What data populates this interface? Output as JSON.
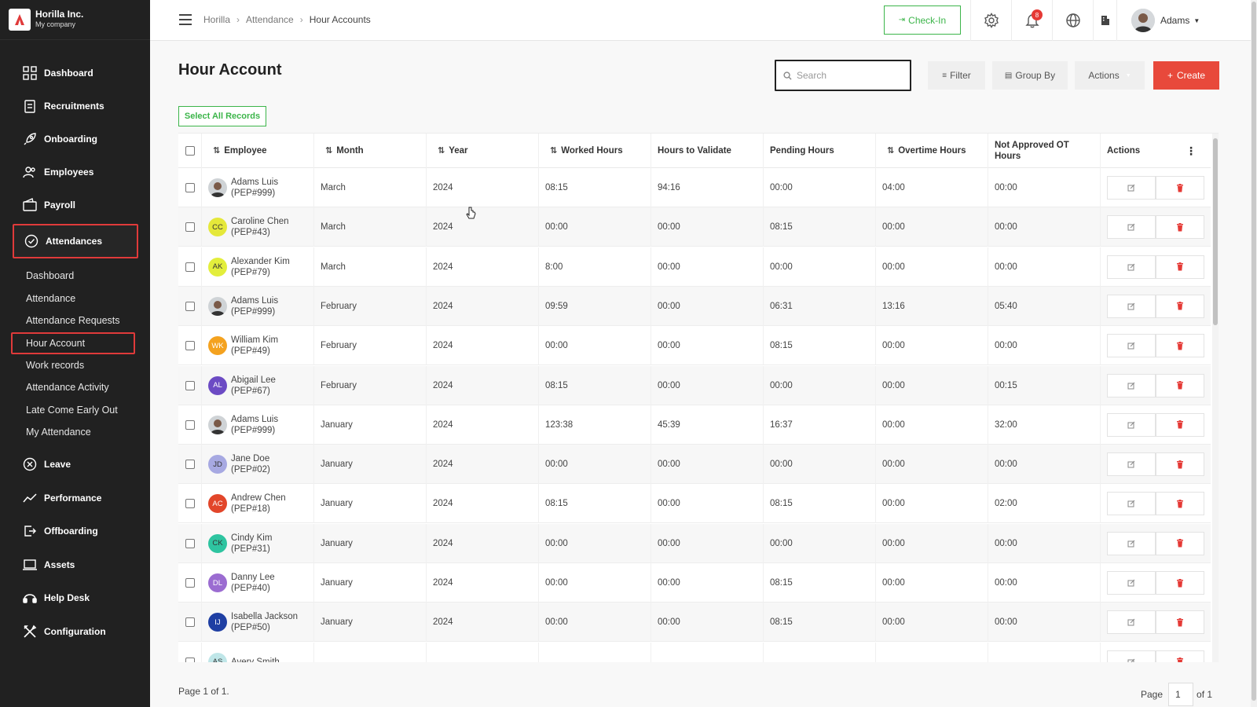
{
  "brand": {
    "name": "Horilla Inc.",
    "subtitle": "My company"
  },
  "sidebar": {
    "items": [
      {
        "label": "Dashboard",
        "icon": "grid-icon"
      },
      {
        "label": "Recruitments",
        "icon": "clipboard-icon"
      },
      {
        "label": "Onboarding",
        "icon": "rocket-icon"
      },
      {
        "label": "Employees",
        "icon": "users-icon"
      },
      {
        "label": "Payroll",
        "icon": "wallet-icon"
      },
      {
        "label": "Attendances",
        "icon": "check-circle-icon",
        "active": true
      },
      {
        "label": "Leave",
        "icon": "x-circle-icon"
      },
      {
        "label": "Performance",
        "icon": "trend-icon"
      },
      {
        "label": "Offboarding",
        "icon": "exit-icon"
      },
      {
        "label": "Assets",
        "icon": "laptop-icon"
      },
      {
        "label": "Help Desk",
        "icon": "headset-icon"
      },
      {
        "label": "Configuration",
        "icon": "tools-icon"
      }
    ],
    "sub_items": [
      {
        "label": "Dashboard"
      },
      {
        "label": "Attendance"
      },
      {
        "label": "Attendance Requests"
      },
      {
        "label": "Hour Account",
        "active": true
      },
      {
        "label": "Work records"
      },
      {
        "label": "Attendance Activity"
      },
      {
        "label": "Late Come Early Out"
      },
      {
        "label": "My Attendance"
      }
    ]
  },
  "topbar": {
    "breadcrumb": [
      "Horilla",
      "Attendance",
      "Hour Accounts"
    ],
    "checkin_label": "Check-In",
    "notification_count": "8",
    "user_name": "Adams"
  },
  "page": {
    "title": "Hour Account",
    "search_placeholder": "Search",
    "filter_label": "Filter",
    "group_by_label": "Group By",
    "actions_label": "Actions",
    "create_label": "Create",
    "select_all_label": "Select All Records"
  },
  "table": {
    "headers": [
      "Employee",
      "Month",
      "Year",
      "Worked Hours",
      "Hours to Validate",
      "Pending Hours",
      "Overtime Hours",
      "Not Approved OT Hours",
      "Actions"
    ],
    "rows": [
      {
        "name": "Adams Luis",
        "id": "(PEP#999)",
        "initials": "",
        "avatar_color": "#cfd3d6",
        "photo": true,
        "month": "March",
        "year": "2024",
        "worked": "08:15",
        "validate": "94:16",
        "pending": "00:00",
        "overtime": "04:00",
        "not_approved": "00:00"
      },
      {
        "name": "Caroline Chen",
        "id": "(PEP#43)",
        "initials": "CC",
        "avatar_color": "#e5e83a",
        "photo": false,
        "month": "March",
        "year": "2024",
        "worked": "00:00",
        "validate": "00:00",
        "pending": "08:15",
        "overtime": "00:00",
        "not_approved": "00:00"
      },
      {
        "name": "Alexander Kim",
        "id": "(PEP#79)",
        "initials": "AK",
        "avatar_color": "#e3ee3c",
        "photo": false,
        "month": "March",
        "year": "2024",
        "worked": "8:00",
        "validate": "00:00",
        "pending": "00:00",
        "overtime": "00:00",
        "not_approved": "00:00"
      },
      {
        "name": "Adams Luis",
        "id": "(PEP#999)",
        "initials": "",
        "avatar_color": "#cfd3d6",
        "photo": true,
        "month": "February",
        "year": "2024",
        "worked": "09:59",
        "validate": "00:00",
        "pending": "06:31",
        "overtime": "13:16",
        "not_approved": "05:40"
      },
      {
        "name": "William Kim",
        "id": "(PEP#49)",
        "initials": "WK",
        "avatar_color": "#f4a21f",
        "photo": false,
        "month": "February",
        "year": "2024",
        "worked": "00:00",
        "validate": "00:00",
        "pending": "08:15",
        "overtime": "00:00",
        "not_approved": "00:00"
      },
      {
        "name": "Abigail Lee",
        "id": "(PEP#67)",
        "initials": "AL",
        "avatar_color": "#6c4bc4",
        "photo": false,
        "month": "February",
        "year": "2024",
        "worked": "08:15",
        "validate": "00:00",
        "pending": "00:00",
        "overtime": "00:00",
        "not_approved": "00:15"
      },
      {
        "name": "Adams Luis",
        "id": "(PEP#999)",
        "initials": "",
        "avatar_color": "#cfd3d6",
        "photo": true,
        "month": "January",
        "year": "2024",
        "worked": "123:38",
        "validate": "45:39",
        "pending": "16:37",
        "overtime": "00:00",
        "not_approved": "32:00"
      },
      {
        "name": "Jane Doe",
        "id": "(PEP#02)",
        "initials": "JD",
        "avatar_color": "#a7a9e2",
        "photo": false,
        "month": "January",
        "year": "2024",
        "worked": "00:00",
        "validate": "00:00",
        "pending": "00:00",
        "overtime": "00:00",
        "not_approved": "00:00"
      },
      {
        "name": "Andrew Chen",
        "id": "(PEP#18)",
        "initials": "AC",
        "avatar_color": "#e2462a",
        "photo": false,
        "month": "January",
        "year": "2024",
        "worked": "08:15",
        "validate": "00:00",
        "pending": "08:15",
        "overtime": "00:00",
        "not_approved": "02:00"
      },
      {
        "name": "Cindy Kim",
        "id": "(PEP#31)",
        "initials": "CK",
        "avatar_color": "#2ec4a0",
        "photo": false,
        "month": "January",
        "year": "2024",
        "worked": "00:00",
        "validate": "00:00",
        "pending": "00:00",
        "overtime": "00:00",
        "not_approved": "00:00"
      },
      {
        "name": "Danny Lee",
        "id": "(PEP#40)",
        "initials": "DL",
        "avatar_color": "#9b6cd1",
        "photo": false,
        "month": "January",
        "year": "2024",
        "worked": "00:00",
        "validate": "00:00",
        "pending": "08:15",
        "overtime": "00:00",
        "not_approved": "00:00"
      },
      {
        "name": "Isabella Jackson",
        "id": "(PEP#50)",
        "initials": "IJ",
        "avatar_color": "#1f3fa3",
        "photo": false,
        "month": "January",
        "year": "2024",
        "worked": "00:00",
        "validate": "00:00",
        "pending": "08:15",
        "overtime": "00:00",
        "not_approved": "00:00"
      },
      {
        "name": "Avery Smith",
        "id": "",
        "initials": "AS",
        "avatar_color": "#bfe6e8",
        "photo": false,
        "month": "",
        "year": "",
        "worked": "",
        "validate": "",
        "pending": "",
        "overtime": "",
        "not_approved": ""
      }
    ]
  },
  "footer": {
    "page_info": "Page 1 of 1.",
    "page_label": "Page",
    "page_value": "1",
    "of_label": "of 1"
  },
  "colors": {
    "sidebar_bg": "#212121",
    "accent_red": "#e8493b",
    "accent_green": "#3cb54a",
    "active_border": "#e03a3a"
  }
}
